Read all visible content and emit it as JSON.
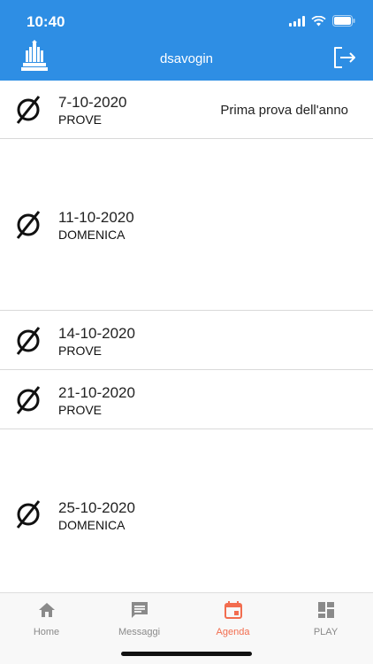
{
  "status_bar": {
    "time": "10:40"
  },
  "header": {
    "title": "dsavogin"
  },
  "agenda": [
    {
      "date": "7-10-2020",
      "type": "PROVE",
      "note": "Prima prova dell'anno"
    },
    {
      "date": "11-10-2020",
      "type": "DOMENICA",
      "note": ""
    },
    {
      "date": "14-10-2020",
      "type": "PROVE",
      "note": ""
    },
    {
      "date": "21-10-2020",
      "type": "PROVE",
      "note": ""
    },
    {
      "date": "25-10-2020",
      "type": "DOMENICA",
      "note": ""
    }
  ],
  "tabs": [
    {
      "label": "Home",
      "icon": "home-icon",
      "active": false
    },
    {
      "label": "Messaggi",
      "icon": "message-icon",
      "active": false
    },
    {
      "label": "Agenda",
      "icon": "calendar-icon",
      "active": true
    },
    {
      "label": "PLAY",
      "icon": "dashboard-icon",
      "active": false
    }
  ],
  "colors": {
    "header": "#2e8ee4",
    "active_tab": "#f26d4f",
    "inactive_tab": "#8a8a8a"
  }
}
